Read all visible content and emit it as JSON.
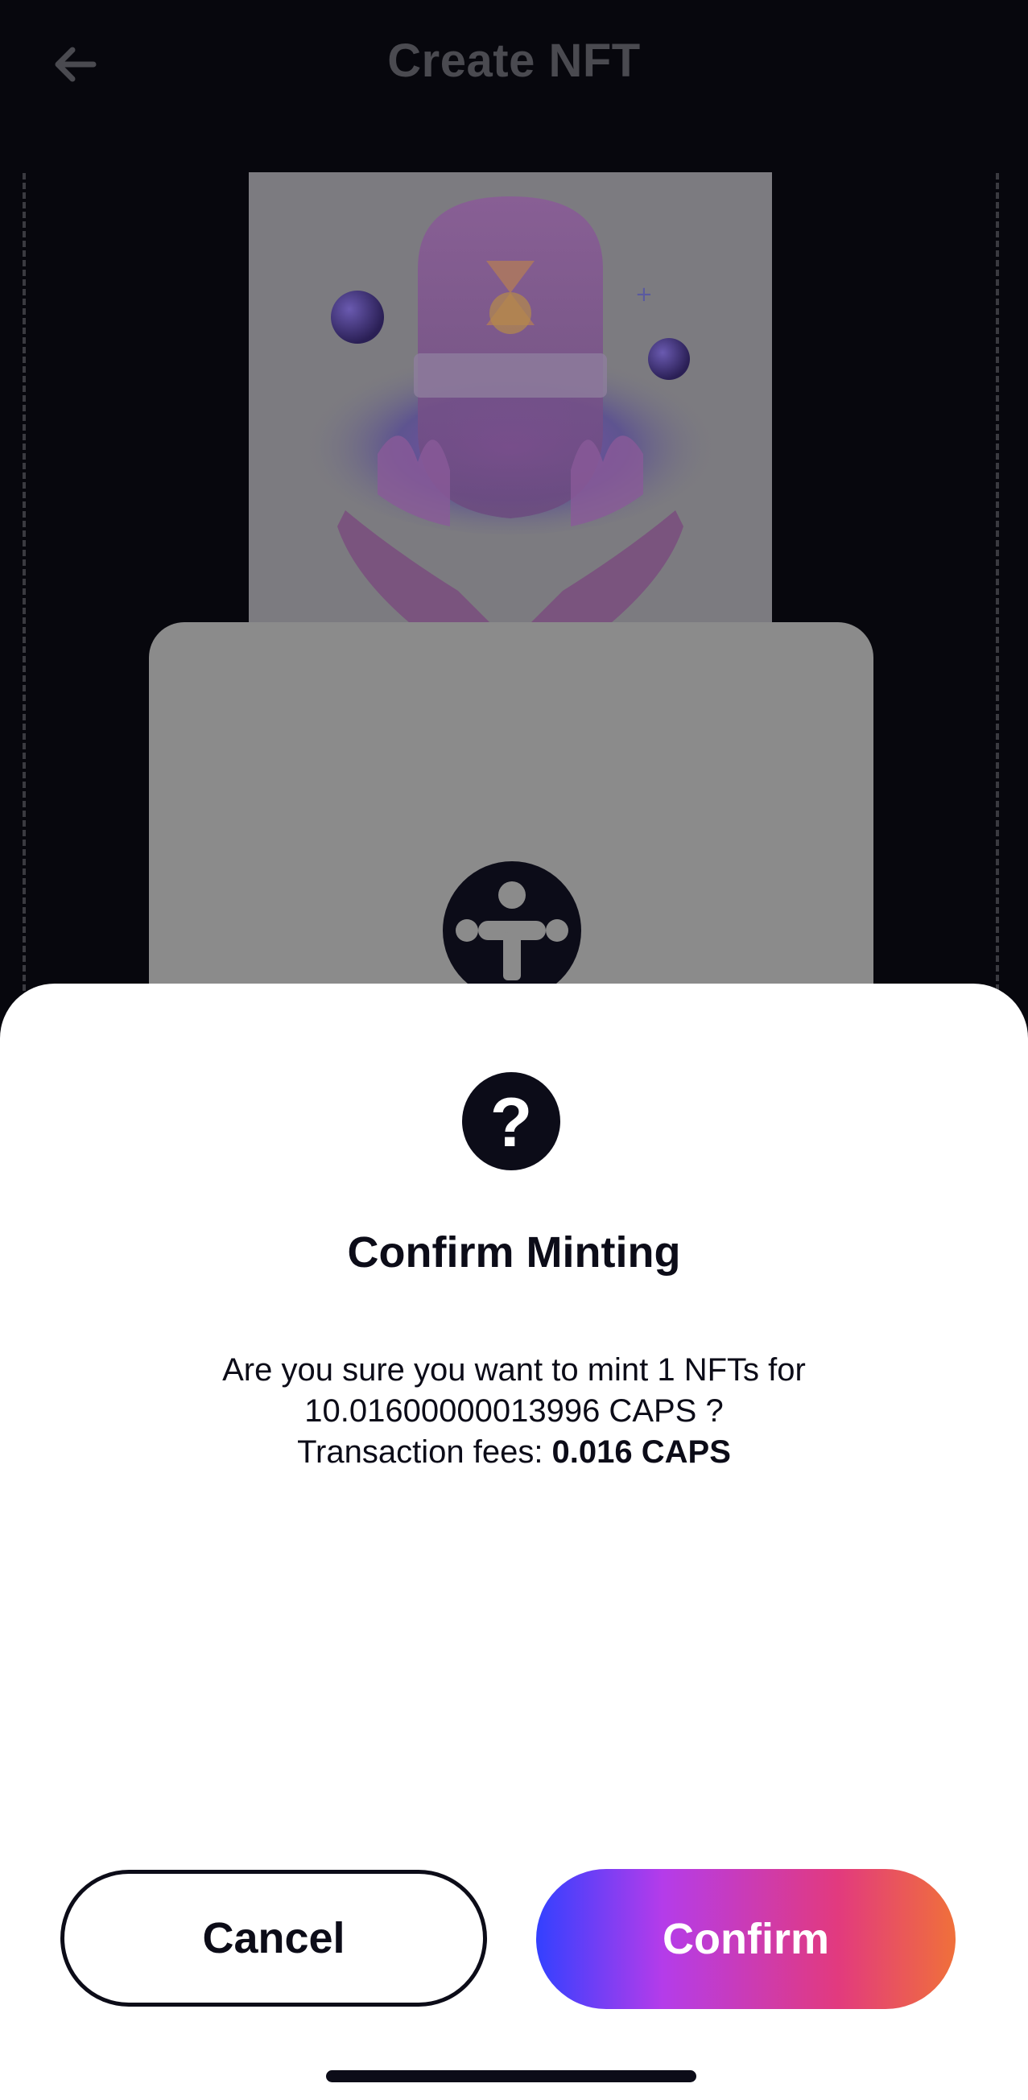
{
  "header": {
    "title": "Create NFT",
    "back_icon": "arrow-left-icon"
  },
  "preview": {
    "artwork": "crystal-pod-in-hands-illustration",
    "card_logo_icon": "ternoa-logo-icon"
  },
  "dialog": {
    "icon": "question-mark-icon",
    "icon_glyph": "?",
    "title": "Confirm Minting",
    "message_line1": "Are you sure you want to mint 1 NFTs for",
    "message_line2": "10.01600000013996 CAPS ?",
    "fees_label": "Transaction fees: ",
    "fees_value": "0.016 CAPS",
    "cancel_label": "Cancel",
    "confirm_label": "Confirm"
  },
  "colors": {
    "background_screen": "#07070d",
    "sheet": "#ffffff",
    "text_dark": "#0c0c18",
    "confirm_gradient": [
      "#3340ff",
      "#b43cea",
      "#e23a7e",
      "#f0703a"
    ]
  }
}
